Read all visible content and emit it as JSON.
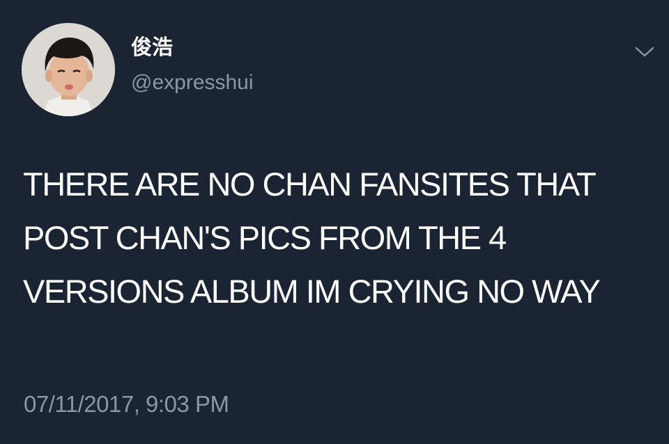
{
  "tweet": {
    "author": {
      "display_name": "俊浩",
      "handle": "@expresshui",
      "avatar_icon": "user-avatar-photo"
    },
    "menu_icon": "chevron-down-icon",
    "text": "THERE ARE NO CHAN FANSITES THAT POST CHAN'S PICS FROM THE 4 VERSIONS ALBUM IM CRYING NO WAY",
    "timestamp": "07/11/2017, 9:03 PM"
  },
  "colors": {
    "background": "#1b2432",
    "primary_text": "#ffffff",
    "secondary_text": "#8899a6"
  }
}
